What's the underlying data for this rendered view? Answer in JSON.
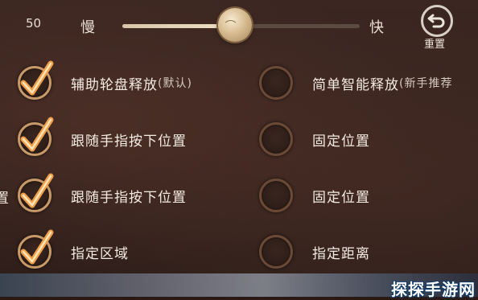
{
  "speed": {
    "value_text": "50",
    "slow_label": "慢",
    "fast_label": "快",
    "level": 0.5
  },
  "reset": {
    "label": "重置",
    "icon": "undo-arrow-icon"
  },
  "left_column": [
    {
      "label": "辅助轮盘释放",
      "sub": "(默认)",
      "checked": true
    },
    {
      "label": "跟随手指按下位置",
      "sub": "",
      "checked": true
    },
    {
      "label": "跟随手指按下位置",
      "sub": "",
      "checked": true
    },
    {
      "label": "指定区域",
      "sub": "",
      "checked": true
    }
  ],
  "right_column": [
    {
      "label": "简单智能释放",
      "sub": "(新手推荐",
      "checked": false
    },
    {
      "label": "固定位置",
      "sub": "",
      "checked": false
    },
    {
      "label": "固定位置",
      "sub": "",
      "checked": false
    },
    {
      "label": "指定距离",
      "sub": "",
      "checked": false
    }
  ],
  "cut_off_left_text": "置",
  "watermark": "探探手游网",
  "colors": {
    "check_orange": "#f0a04a",
    "panel_bg": "#35221d",
    "text": "#f3ebe1"
  }
}
